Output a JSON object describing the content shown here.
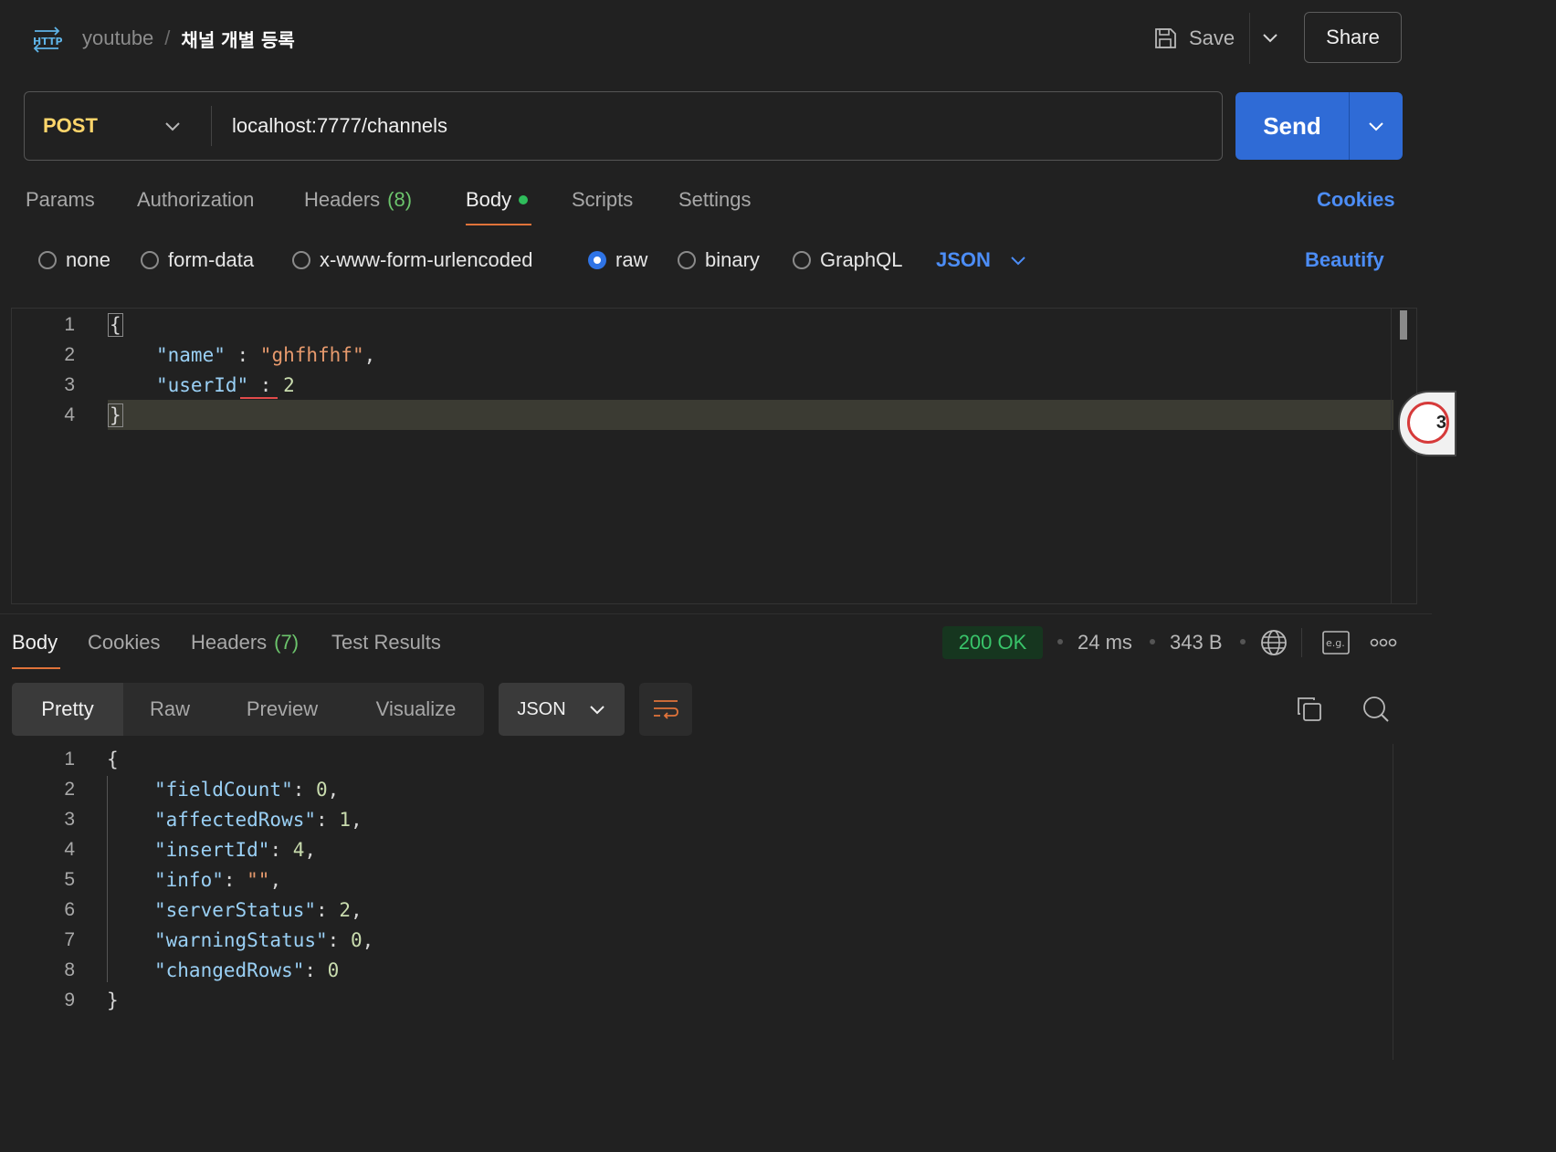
{
  "header": {
    "icon": "http-icon",
    "breadcrumb_parent": "youtube",
    "breadcrumb_separator": "/",
    "breadcrumb_current": "채널 개별 등록",
    "save_label": "Save",
    "share_label": "Share"
  },
  "request": {
    "method": "POST",
    "url": "localhost:7777/channels",
    "send_label": "Send"
  },
  "request_tabs": {
    "params": "Params",
    "authorization": "Authorization",
    "headers": "Headers",
    "headers_count": "(8)",
    "body": "Body",
    "scripts": "Scripts",
    "settings": "Settings",
    "cookies": "Cookies",
    "active": "Body"
  },
  "body_types": {
    "none": "none",
    "form_data": "form-data",
    "urlencoded": "x-www-form-urlencoded",
    "raw": "raw",
    "binary": "binary",
    "graphql": "GraphQL",
    "selected": "raw",
    "language": "JSON",
    "beautify": "Beautify"
  },
  "request_body": {
    "line_numbers": [
      "1",
      "2",
      "3",
      "4"
    ],
    "l1_brace": "{",
    "l2_key": "\"name\"",
    "l2_colon": " : ",
    "l2_value": "\"ghfhfhf\"",
    "l2_comma": ",",
    "l3_key": "\"userId\"",
    "l3_colon": " : ",
    "l3_value": "2",
    "l4_brace": "}"
  },
  "floating_badge": "3",
  "response_tabs": {
    "body": "Body",
    "cookies": "Cookies",
    "headers": "Headers",
    "headers_count": "(7)",
    "test_results": "Test Results",
    "active": "Body"
  },
  "response_meta": {
    "status": "200 OK",
    "time": "24 ms",
    "size": "343 B",
    "status_color": "#39c46a"
  },
  "response_view": {
    "pretty": "Pretty",
    "raw": "Raw",
    "preview": "Preview",
    "visualize": "Visualize",
    "active": "Pretty",
    "format": "JSON"
  },
  "response_body": {
    "line_numbers": [
      "1",
      "2",
      "3",
      "4",
      "5",
      "6",
      "7",
      "8",
      "9"
    ],
    "open_brace": "{",
    "close_brace": "}",
    "fields": [
      {
        "key": "\"fieldCount\"",
        "value": "0",
        "comma": ","
      },
      {
        "key": "\"affectedRows\"",
        "value": "1",
        "comma": ","
      },
      {
        "key": "\"insertId\"",
        "value": "4",
        "comma": ","
      },
      {
        "key": "\"info\"",
        "value": "\"\"",
        "comma": ","
      },
      {
        "key": "\"serverStatus\"",
        "value": "2",
        "comma": ","
      },
      {
        "key": "\"warningStatus\"",
        "value": "0",
        "comma": ","
      },
      {
        "key": "\"changedRows\"",
        "value": "0",
        "comma": ""
      }
    ]
  },
  "colors": {
    "accent_blue": "#2f6bd6",
    "link_blue": "#4c8df6",
    "method_yellow": "#ffd66b",
    "tab_underline": "#e0733a",
    "json_key": "#9ad0f5",
    "json_string": "#e79a6d",
    "json_number": "#c9dcae"
  }
}
